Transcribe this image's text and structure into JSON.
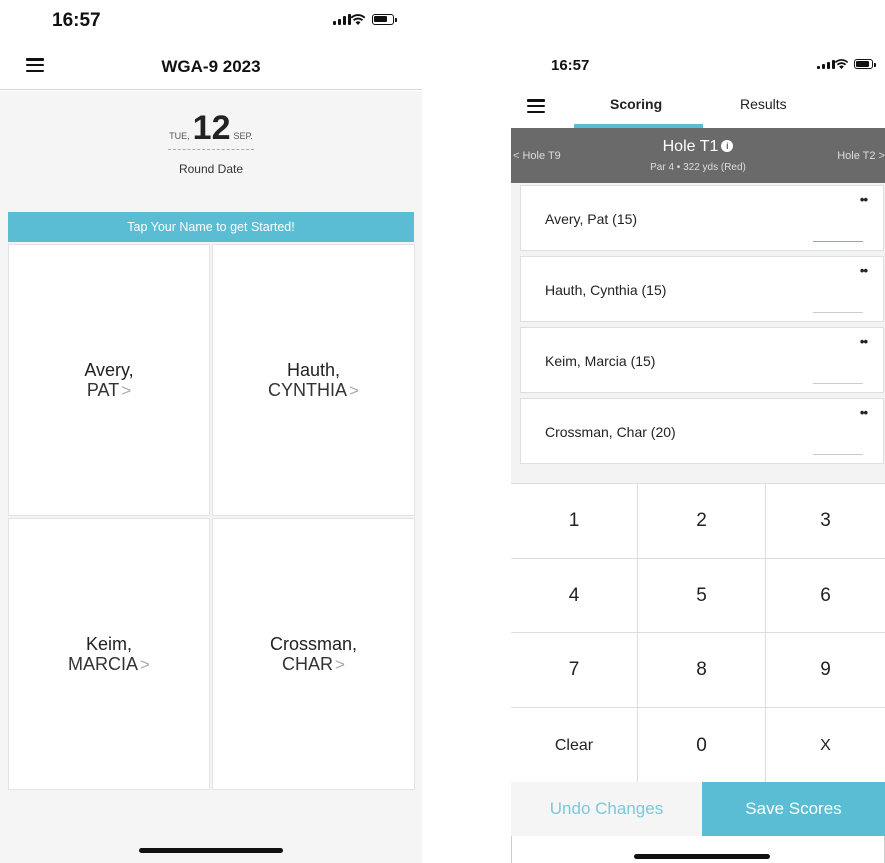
{
  "left_screen": {
    "status": {
      "time": "16:57"
    },
    "title": "WGA-9 2023",
    "date": {
      "dow": "TUE,",
      "day": "12",
      "mon": "SEP."
    },
    "round_label": "Round Date",
    "banner": "Tap Your Name to get Started!",
    "players": [
      {
        "last": "Avery,",
        "first": "PAT"
      },
      {
        "last": "Hauth,",
        "first": "CYNTHIA"
      },
      {
        "last": "Keim,",
        "first": "MARCIA"
      },
      {
        "last": "Crossman,",
        "first": "CHAR"
      }
    ],
    "chevron": ">"
  },
  "right_screen": {
    "status": {
      "time": "16:57"
    },
    "tabs": [
      "Scoring",
      "Results"
    ],
    "hole": {
      "prev": "< Hole T9",
      "next": "Hole T2 >",
      "title": "Hole T1",
      "info_icon": "i",
      "subtitle": "Par 4 • 322 yds (Red)"
    },
    "players": [
      {
        "name": "Avery, Pat (15)"
      },
      {
        "name": "Hauth, Cynthia (15)"
      },
      {
        "name": "Keim, Marcia (15)"
      },
      {
        "name": "Crossman, Char (20)"
      }
    ],
    "more_icon": "••",
    "keypad": [
      "1",
      "2",
      "3",
      "4",
      "5",
      "6",
      "7",
      "8",
      "9",
      "Clear",
      "0",
      "X"
    ],
    "undo_label": "Undo Changes",
    "save_label": "Save Scores"
  },
  "colors": {
    "accent": "#5bbdd4",
    "hole_bar": "#6a6a6a"
  },
  "icons": [
    "menu-icon",
    "signal-icon",
    "wifi-icon",
    "battery-icon",
    "info-icon",
    "more-icon"
  ]
}
